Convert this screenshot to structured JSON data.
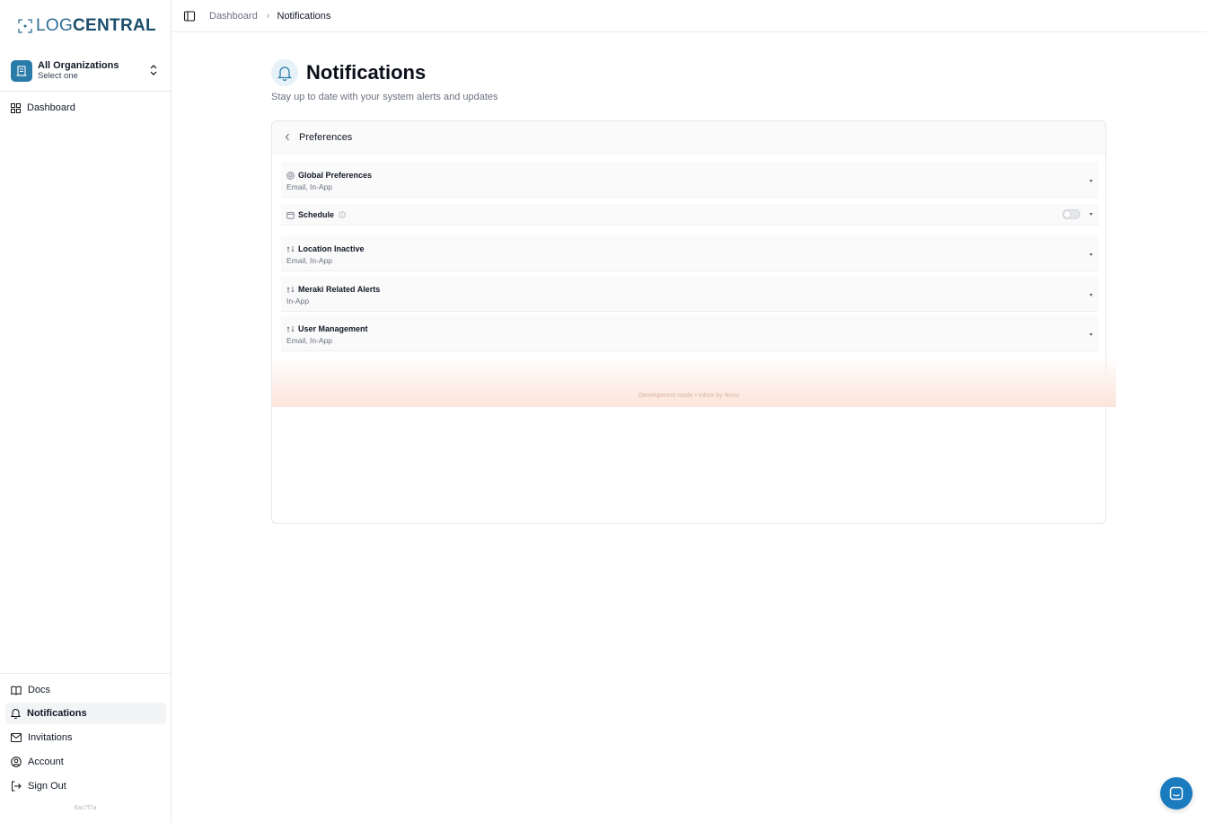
{
  "brand": {
    "part1": "LOG",
    "part2": "CENTRAL",
    "accent": "#1e5a7a"
  },
  "org_switcher": {
    "name": "All Organizations",
    "subtitle": "Select one"
  },
  "sidebar": {
    "top_items": [
      {
        "label": "Dashboard",
        "icon": "grid-icon"
      }
    ],
    "bottom_items": [
      {
        "label": "Docs",
        "icon": "book-icon"
      },
      {
        "label": "Notifications",
        "icon": "bell-icon",
        "active": true
      },
      {
        "label": "Invitations",
        "icon": "mail-icon"
      },
      {
        "label": "Account",
        "icon": "user-circle-icon"
      },
      {
        "label": "Sign Out",
        "icon": "logout-icon"
      }
    ],
    "version": "6ac7f7a"
  },
  "breadcrumb": {
    "parent": "Dashboard",
    "current": "Notifications"
  },
  "page": {
    "title": "Notifications",
    "subtitle": "Stay up to date with your system alerts and updates"
  },
  "preferences": {
    "header": "Preferences",
    "rows": [
      {
        "title": "Global Preferences",
        "channels": "Email, In-App",
        "icon": "globe-icon"
      },
      {
        "title": "Schedule",
        "channels": "",
        "icon": "calendar-icon",
        "toggle": false
      },
      {
        "title": "Location Inactive",
        "channels": "Email, In-App",
        "icon": "workflow-icon"
      },
      {
        "title": "Meraki Related Alerts",
        "channels": "In-App",
        "icon": "workflow-icon"
      },
      {
        "title": "User Management",
        "channels": "Email, In-App",
        "icon": "workflow-icon"
      }
    ],
    "footer": "Development mode • Inbox by Novu"
  },
  "chat": {
    "icon": "chat-icon",
    "color": "#1a7bbf"
  }
}
